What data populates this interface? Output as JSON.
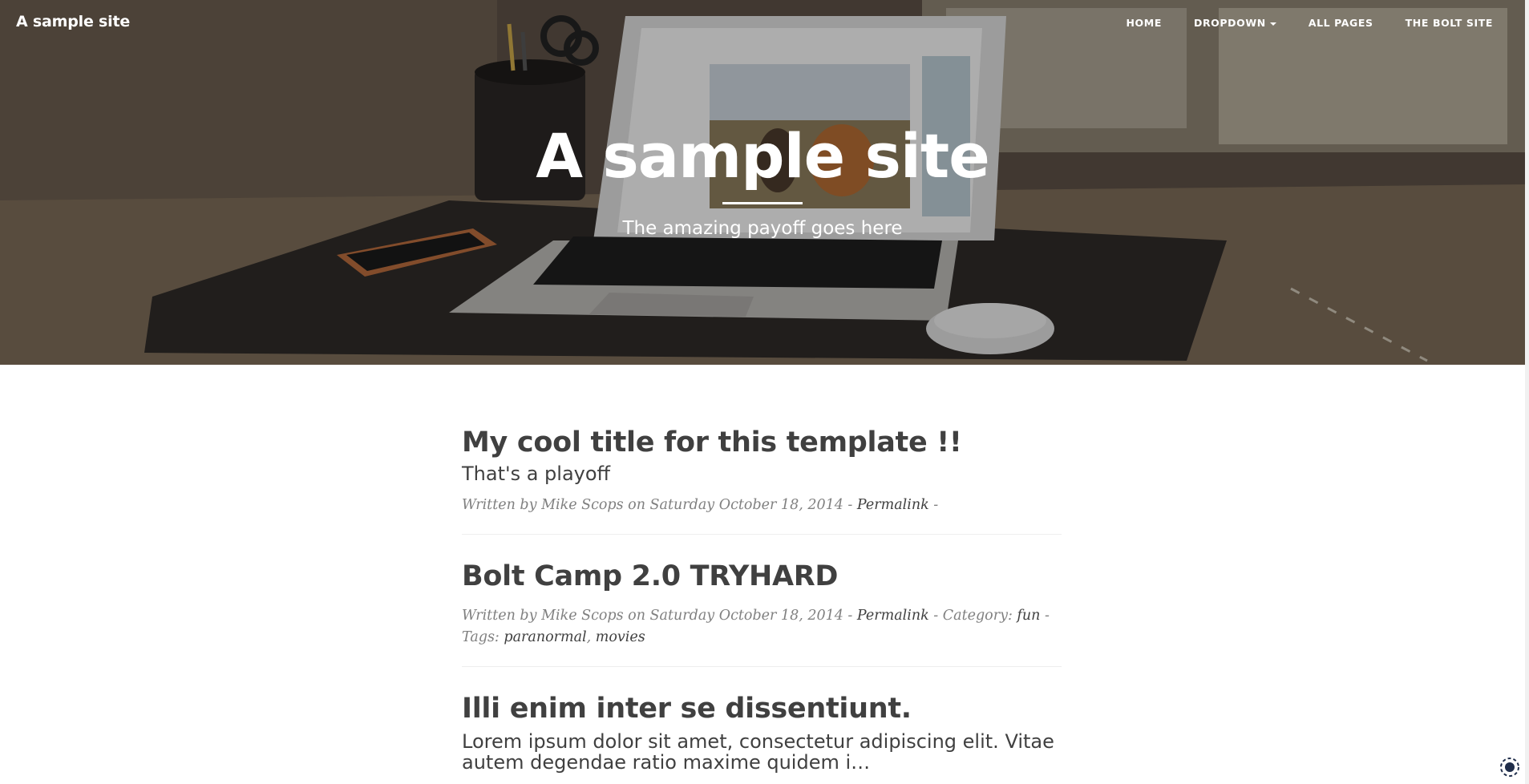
{
  "brand": {
    "title": "A sample site"
  },
  "nav": {
    "items": [
      {
        "label": "HOME"
      },
      {
        "label": "DROPDOWN"
      },
      {
        "label": "ALL PAGES"
      },
      {
        "label": "THE BOLT SITE"
      }
    ]
  },
  "hero": {
    "title": "A sample site",
    "subtitle": "The amazing payoff goes here"
  },
  "posts": [
    {
      "title": "My cool title for this template !!",
      "subtitle": "That's a playoff",
      "meta_prefix": "Written by Mike Scops on Saturday October 18, 2014 - ",
      "permalink": "Permalink",
      "meta_suffix": " -"
    },
    {
      "title": "Bolt Camp 2.0 TRYHARD",
      "meta_prefix": "Written by Mike Scops on Saturday October 18, 2014 - ",
      "permalink": "Permalink",
      "category_label": " - Category: ",
      "category": "fun",
      "tags_label": " - Tags: ",
      "tag1": "paranormal",
      "tag_sep": ", ",
      "tag2": "movies"
    },
    {
      "title": "Illi enim inter se dissentiunt.",
      "excerpt": "Lorem ipsum dolor sit amet, consectetur adipiscing elit. Vitae autem degendae ratio maxime quidem i…"
    }
  ],
  "colors": {
    "text": "#404040",
    "meta": "#808080",
    "hero_text": "#ffffff"
  }
}
